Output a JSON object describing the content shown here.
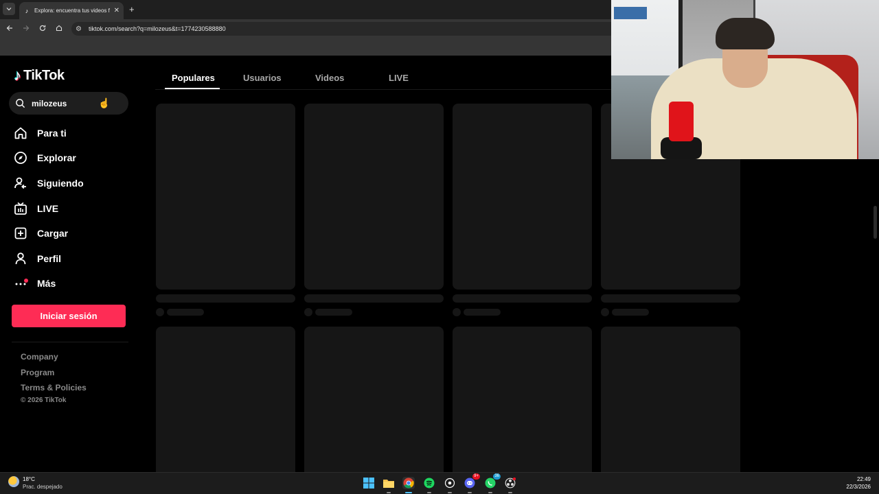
{
  "browser": {
    "tab_title": "Explora: encuentra tus videos fa",
    "tab_close": "✕",
    "new_tab": "+",
    "url": "tiktok.com/search?q=milozeus&t=1774230588880"
  },
  "tiktok": {
    "logo_text": "TikTok",
    "search_value": "milozeus",
    "nav": [
      {
        "label": "Para ti",
        "icon": "home-icon"
      },
      {
        "label": "Explorar",
        "icon": "compass-icon"
      },
      {
        "label": "Siguiendo",
        "icon": "following-icon"
      },
      {
        "label": "LIVE",
        "icon": "live-tv-icon"
      },
      {
        "label": "Cargar",
        "icon": "upload-plus-icon"
      },
      {
        "label": "Perfil",
        "icon": "profile-icon"
      },
      {
        "label": "Más",
        "icon": "more-dots-icon"
      }
    ],
    "login_label": "Iniciar sesión",
    "footer": {
      "company": "Company",
      "program": "Program",
      "terms": "Terms & Policies",
      "copyright": "© 2026 TikTok"
    },
    "search_tabs": [
      "Populares",
      "Usuarios",
      "Videos",
      "LIVE"
    ],
    "active_tab": "Populares"
  },
  "taskbar": {
    "weather_temp": "18°C",
    "weather_desc": "Prac. despejado",
    "discord_badge": "9+",
    "whatsapp_badge": "36",
    "time": "22:49",
    "date": "22/3/2026"
  },
  "colors": {
    "accent": "#fe2c55",
    "background": "#000000",
    "skeleton": "#161616"
  }
}
